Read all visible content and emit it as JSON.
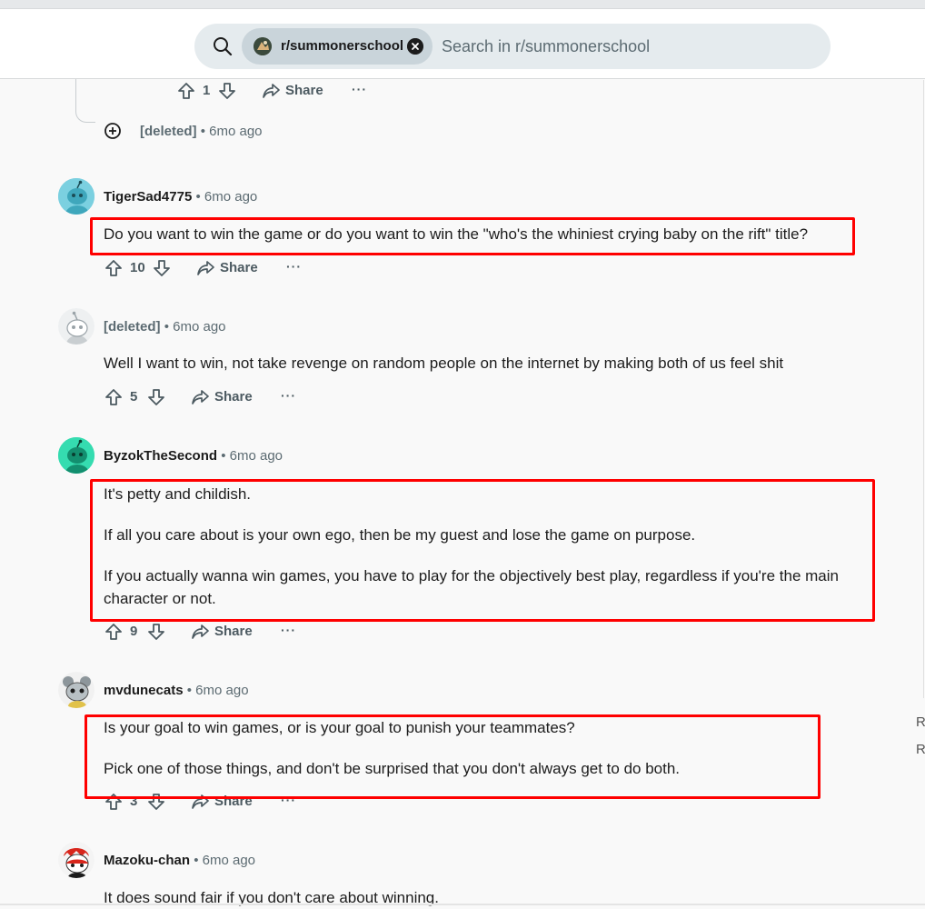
{
  "search": {
    "subreddit_chip": "r/summonerschool",
    "placeholder": "Search in r/summonerschool"
  },
  "top_actions": {
    "votes": "1",
    "share": "Share",
    "more": "···"
  },
  "collapsed_comment": {
    "author": "[deleted]",
    "sep": "•",
    "time": "6mo ago"
  },
  "comments": [
    {
      "author": "TigerSad4775",
      "sep": "•",
      "time": "6mo ago",
      "paragraphs": [
        "Do you want to win the game or do you want to win the \"who's the whiniest crying baby on the rift\" title?"
      ],
      "votes": "10",
      "share": "Share",
      "more": "···"
    },
    {
      "author": "[deleted]",
      "sep": "•",
      "time": "6mo ago",
      "paragraphs": [
        "Well I want to win, not take revenge on random people on the internet by making both of us feel shit"
      ],
      "votes": "5",
      "share": "Share",
      "more": "···"
    },
    {
      "author": "ByzokTheSecond",
      "sep": "•",
      "time": "6mo ago",
      "paragraphs": [
        "It's petty and childish.",
        "If all you care about is your own ego, then be my guest and lose the game on purpose.",
        "If you actually wanna win games, you have to play for the objectively best play, regardless if you're the main character or not."
      ],
      "votes": "9",
      "share": "Share",
      "more": "···"
    },
    {
      "author": "mvdunecats",
      "sep": "•",
      "time": "6mo ago",
      "paragraphs": [
        "Is your goal to win games, or is your goal to punish your teammates?",
        "Pick one of those things, and don't be surprised that you don't always get to do both."
      ],
      "votes": "3",
      "share": "Share",
      "more": "···"
    },
    {
      "author": "Mazoku-chan",
      "sep": "•",
      "time": "6mo ago",
      "paragraphs": [
        "It does sound fair if you don't care about winning."
      ]
    }
  ],
  "right_fragments": [
    "R",
    "R"
  ],
  "colors": {
    "highlight": "#ff0000",
    "meta_gray": "#5c6b72",
    "search_bg": "#e5ebee"
  },
  "icons": [
    "search-icon",
    "close-icon",
    "upvote-icon",
    "downvote-icon",
    "share-icon",
    "expand-icon"
  ]
}
